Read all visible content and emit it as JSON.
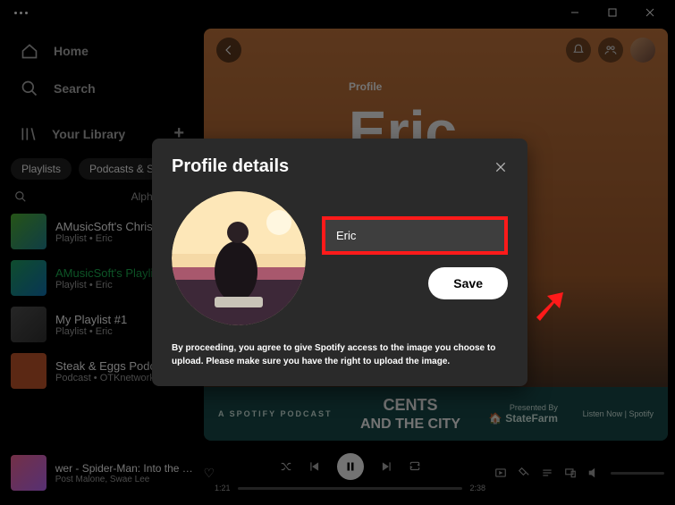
{
  "titlebar": {},
  "sidebar": {
    "home": "Home",
    "search": "Search",
    "library": "Your Library",
    "pills": [
      "Playlists",
      "Podcasts & Shows"
    ],
    "sort_label": "Alphabetical",
    "items": [
      {
        "title": "AMusicSoft's Christmas",
        "sub": "Playlist • Eric"
      },
      {
        "title": "AMusicSoft's Playlist",
        "sub": "Playlist • Eric"
      },
      {
        "title": "My Playlist #1",
        "sub": "Playlist • Eric"
      },
      {
        "title": "Steak & Eggs Podcast",
        "sub": "Podcast • OTKnetwork"
      }
    ]
  },
  "main": {
    "profile_label": "Profile",
    "profile_name": "Eric"
  },
  "ad": {
    "left": "A SPOTIFY PODCAST",
    "mid": "Cents and the City",
    "right_top": "Presented By",
    "right_brand": "StateFarm",
    "right_cta": "Listen Now | Spotify"
  },
  "player": {
    "title": "wer - Spider-Man: Into the Sp",
    "sub": "Post Malone, Swae Lee",
    "time_current": "1:21",
    "time_total": "2:38"
  },
  "modal": {
    "title": "Profile details",
    "name_value": "Eric",
    "save": "Save",
    "disclaimer": "By proceeding, you agree to give Spotify access to the image you choose to upload. Please make sure you have the right to upload the image."
  }
}
